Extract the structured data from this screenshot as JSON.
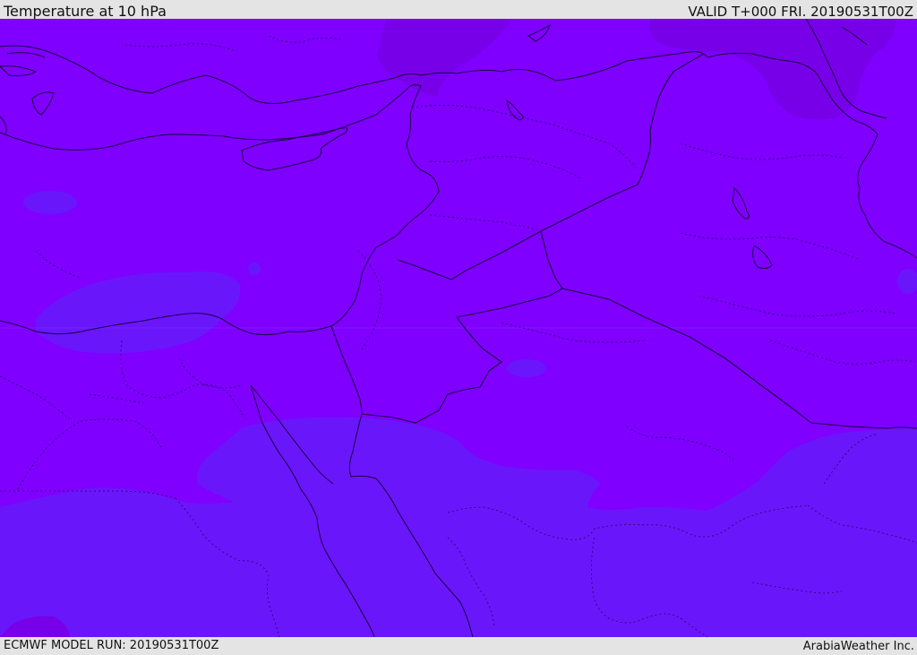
{
  "header": {
    "title": "Temperature at 10 hPa",
    "valid": "VALID T+000 FRI. 20190531T00Z"
  },
  "footer": {
    "model_run": "ECMWF MODEL RUN: 20190531T00Z",
    "brand": "ArabiaWeather Inc."
  },
  "map": {
    "colors": {
      "background_band": "#7f00ff",
      "cool_band": "#6a16fb",
      "warm_band": "#7700e8",
      "boundaries": "#1a0040"
    }
  }
}
